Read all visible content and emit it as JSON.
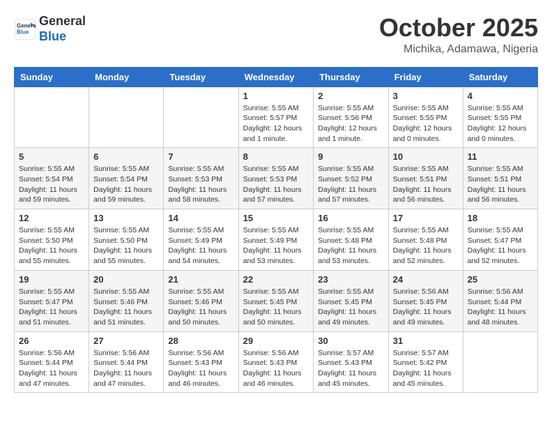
{
  "header": {
    "logo_general": "General",
    "logo_blue": "Blue",
    "month_title": "October 2025",
    "location": "Michika, Adamawa, Nigeria"
  },
  "days_of_week": [
    "Sunday",
    "Monday",
    "Tuesday",
    "Wednesday",
    "Thursday",
    "Friday",
    "Saturday"
  ],
  "weeks": [
    [
      {
        "day": "",
        "sunrise": "",
        "sunset": "",
        "daylight": ""
      },
      {
        "day": "",
        "sunrise": "",
        "sunset": "",
        "daylight": ""
      },
      {
        "day": "",
        "sunrise": "",
        "sunset": "",
        "daylight": ""
      },
      {
        "day": "1",
        "sunrise": "Sunrise: 5:55 AM",
        "sunset": "Sunset: 5:57 PM",
        "daylight": "Daylight: 12 hours and 1 minute."
      },
      {
        "day": "2",
        "sunrise": "Sunrise: 5:55 AM",
        "sunset": "Sunset: 5:56 PM",
        "daylight": "Daylight: 12 hours and 1 minute."
      },
      {
        "day": "3",
        "sunrise": "Sunrise: 5:55 AM",
        "sunset": "Sunset: 5:55 PM",
        "daylight": "Daylight: 12 hours and 0 minutes."
      },
      {
        "day": "4",
        "sunrise": "Sunrise: 5:55 AM",
        "sunset": "Sunset: 5:55 PM",
        "daylight": "Daylight: 12 hours and 0 minutes."
      }
    ],
    [
      {
        "day": "5",
        "sunrise": "Sunrise: 5:55 AM",
        "sunset": "Sunset: 5:54 PM",
        "daylight": "Daylight: 11 hours and 59 minutes."
      },
      {
        "day": "6",
        "sunrise": "Sunrise: 5:55 AM",
        "sunset": "Sunset: 5:54 PM",
        "daylight": "Daylight: 11 hours and 59 minutes."
      },
      {
        "day": "7",
        "sunrise": "Sunrise: 5:55 AM",
        "sunset": "Sunset: 5:53 PM",
        "daylight": "Daylight: 11 hours and 58 minutes."
      },
      {
        "day": "8",
        "sunrise": "Sunrise: 5:55 AM",
        "sunset": "Sunset: 5:53 PM",
        "daylight": "Daylight: 11 hours and 57 minutes."
      },
      {
        "day": "9",
        "sunrise": "Sunrise: 5:55 AM",
        "sunset": "Sunset: 5:52 PM",
        "daylight": "Daylight: 11 hours and 57 minutes."
      },
      {
        "day": "10",
        "sunrise": "Sunrise: 5:55 AM",
        "sunset": "Sunset: 5:51 PM",
        "daylight": "Daylight: 11 hours and 56 minutes."
      },
      {
        "day": "11",
        "sunrise": "Sunrise: 5:55 AM",
        "sunset": "Sunset: 5:51 PM",
        "daylight": "Daylight: 11 hours and 56 minutes."
      }
    ],
    [
      {
        "day": "12",
        "sunrise": "Sunrise: 5:55 AM",
        "sunset": "Sunset: 5:50 PM",
        "daylight": "Daylight: 11 hours and 55 minutes."
      },
      {
        "day": "13",
        "sunrise": "Sunrise: 5:55 AM",
        "sunset": "Sunset: 5:50 PM",
        "daylight": "Daylight: 11 hours and 55 minutes."
      },
      {
        "day": "14",
        "sunrise": "Sunrise: 5:55 AM",
        "sunset": "Sunset: 5:49 PM",
        "daylight": "Daylight: 11 hours and 54 minutes."
      },
      {
        "day": "15",
        "sunrise": "Sunrise: 5:55 AM",
        "sunset": "Sunset: 5:49 PM",
        "daylight": "Daylight: 11 hours and 53 minutes."
      },
      {
        "day": "16",
        "sunrise": "Sunrise: 5:55 AM",
        "sunset": "Sunset: 5:48 PM",
        "daylight": "Daylight: 11 hours and 53 minutes."
      },
      {
        "day": "17",
        "sunrise": "Sunrise: 5:55 AM",
        "sunset": "Sunset: 5:48 PM",
        "daylight": "Daylight: 11 hours and 52 minutes."
      },
      {
        "day": "18",
        "sunrise": "Sunrise: 5:55 AM",
        "sunset": "Sunset: 5:47 PM",
        "daylight": "Daylight: 11 hours and 52 minutes."
      }
    ],
    [
      {
        "day": "19",
        "sunrise": "Sunrise: 5:55 AM",
        "sunset": "Sunset: 5:47 PM",
        "daylight": "Daylight: 11 hours and 51 minutes."
      },
      {
        "day": "20",
        "sunrise": "Sunrise: 5:55 AM",
        "sunset": "Sunset: 5:46 PM",
        "daylight": "Daylight: 11 hours and 51 minutes."
      },
      {
        "day": "21",
        "sunrise": "Sunrise: 5:55 AM",
        "sunset": "Sunset: 5:46 PM",
        "daylight": "Daylight: 11 hours and 50 minutes."
      },
      {
        "day": "22",
        "sunrise": "Sunrise: 5:55 AM",
        "sunset": "Sunset: 5:45 PM",
        "daylight": "Daylight: 11 hours and 50 minutes."
      },
      {
        "day": "23",
        "sunrise": "Sunrise: 5:55 AM",
        "sunset": "Sunset: 5:45 PM",
        "daylight": "Daylight: 11 hours and 49 minutes."
      },
      {
        "day": "24",
        "sunrise": "Sunrise: 5:56 AM",
        "sunset": "Sunset: 5:45 PM",
        "daylight": "Daylight: 11 hours and 49 minutes."
      },
      {
        "day": "25",
        "sunrise": "Sunrise: 5:56 AM",
        "sunset": "Sunset: 5:44 PM",
        "daylight": "Daylight: 11 hours and 48 minutes."
      }
    ],
    [
      {
        "day": "26",
        "sunrise": "Sunrise: 5:56 AM",
        "sunset": "Sunset: 5:44 PM",
        "daylight": "Daylight: 11 hours and 47 minutes."
      },
      {
        "day": "27",
        "sunrise": "Sunrise: 5:56 AM",
        "sunset": "Sunset: 5:44 PM",
        "daylight": "Daylight: 11 hours and 47 minutes."
      },
      {
        "day": "28",
        "sunrise": "Sunrise: 5:56 AM",
        "sunset": "Sunset: 5:43 PM",
        "daylight": "Daylight: 11 hours and 46 minutes."
      },
      {
        "day": "29",
        "sunrise": "Sunrise: 5:56 AM",
        "sunset": "Sunset: 5:43 PM",
        "daylight": "Daylight: 11 hours and 46 minutes."
      },
      {
        "day": "30",
        "sunrise": "Sunrise: 5:57 AM",
        "sunset": "Sunset: 5:43 PM",
        "daylight": "Daylight: 11 hours and 45 minutes."
      },
      {
        "day": "31",
        "sunrise": "Sunrise: 5:57 AM",
        "sunset": "Sunset: 5:42 PM",
        "daylight": "Daylight: 11 hours and 45 minutes."
      },
      {
        "day": "",
        "sunrise": "",
        "sunset": "",
        "daylight": ""
      }
    ]
  ]
}
